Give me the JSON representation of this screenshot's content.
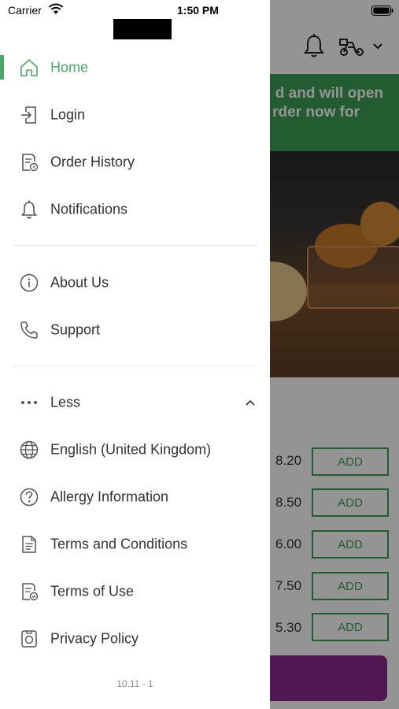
{
  "status_bar": {
    "carrier": "Carrier",
    "time": "1:50 PM"
  },
  "background": {
    "banner_line1": "d and will open",
    "banner_line2": "rder now for",
    "items": [
      {
        "price": "8.20",
        "add_label": "ADD"
      },
      {
        "price": "8.50",
        "add_label": "ADD"
      },
      {
        "price": "6.00",
        "add_label": "ADD"
      },
      {
        "price": "7.50",
        "add_label": "ADD"
      },
      {
        "price": "5.30",
        "add_label": "ADD"
      }
    ]
  },
  "drawer": {
    "items": [
      {
        "label": "Home",
        "icon": "home-icon",
        "active": true
      },
      {
        "label": "Login",
        "icon": "login-icon"
      },
      {
        "label": "Order History",
        "icon": "order-history-icon"
      },
      {
        "label": "Notifications",
        "icon": "bell-icon"
      },
      {
        "label": "About Us",
        "icon": "info-icon"
      },
      {
        "label": "Support",
        "icon": "phone-icon"
      },
      {
        "label": "Less",
        "icon": "more-dots-icon"
      },
      {
        "label": "English (United Kingdom)",
        "icon": "globe-icon"
      },
      {
        "label": "Allergy Information",
        "icon": "question-icon"
      },
      {
        "label": "Terms and Conditions",
        "icon": "document-icon"
      },
      {
        "label": "Terms of Use",
        "icon": "document-check-icon"
      },
      {
        "label": "Privacy Policy",
        "icon": "privacy-icon"
      }
    ],
    "version": "10.11 - 1"
  },
  "colors": {
    "accent": "#4aa86a",
    "banner": "#3f9f57",
    "cart": "#8a2a8e"
  }
}
